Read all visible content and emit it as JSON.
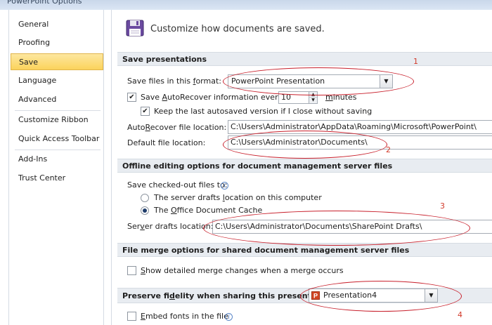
{
  "window": {
    "title": "PowerPoint Options"
  },
  "sidebar": {
    "items": [
      {
        "label": "General"
      },
      {
        "label": "Proofing"
      },
      {
        "label": "Save"
      },
      {
        "label": "Language"
      },
      {
        "label": "Advanced"
      },
      {
        "label": "Customize Ribbon"
      },
      {
        "label": "Quick Access Toolbar"
      },
      {
        "label": "Add-Ins"
      },
      {
        "label": "Trust Center"
      }
    ],
    "selected": "Save"
  },
  "header": {
    "text": "Customize how documents are saved."
  },
  "save_presentations": {
    "title": "Save presentations",
    "format_label": "Save files in this format:",
    "format_value": "PowerPoint Presentation",
    "autorecover_label": "Save AutoRecover information every",
    "autorecover_checked": true,
    "autorecover_minutes": "10",
    "minutes_label": "minutes",
    "keep_last_label": "Keep the last autosaved version if I close without saving",
    "keep_last_checked": true,
    "autorecover_location_label": "AutoRecover file location:",
    "autorecover_location_value": "C:\\Users\\Administrator\\AppData\\Roaming\\Microsoft\\PowerPoint\\",
    "default_location_label": "Default file location:",
    "default_location_value": "C:\\Users\\Administrator\\Documents\\"
  },
  "offline": {
    "title": "Offline editing options for document management server files",
    "checkedout_label": "Save checked-out files to:",
    "option_server_drafts": "The server drafts location on this computer",
    "option_office_cache": "The Office Document Cache",
    "selected_option": "The Office Document Cache",
    "server_drafts_label": "Server drafts location:",
    "server_drafts_value": "C:\\Users\\Administrator\\Documents\\SharePoint Drafts\\"
  },
  "file_merge": {
    "title": "File merge options for shared document management server files",
    "show_merge_label": "Show detailed merge changes when a merge occurs",
    "show_merge_checked": false
  },
  "fidelity": {
    "title": "Preserve fidelity when sharing this presentation:",
    "presentation_value": "Presentation4",
    "embed_fonts_label": "Embed fonts in the file",
    "embed_fonts_checked": false
  },
  "annotations": [
    "1",
    "2",
    "3",
    "4"
  ],
  "colors": {
    "annotation_red": "#c8202c",
    "selected_nav": "#fbd35b"
  }
}
